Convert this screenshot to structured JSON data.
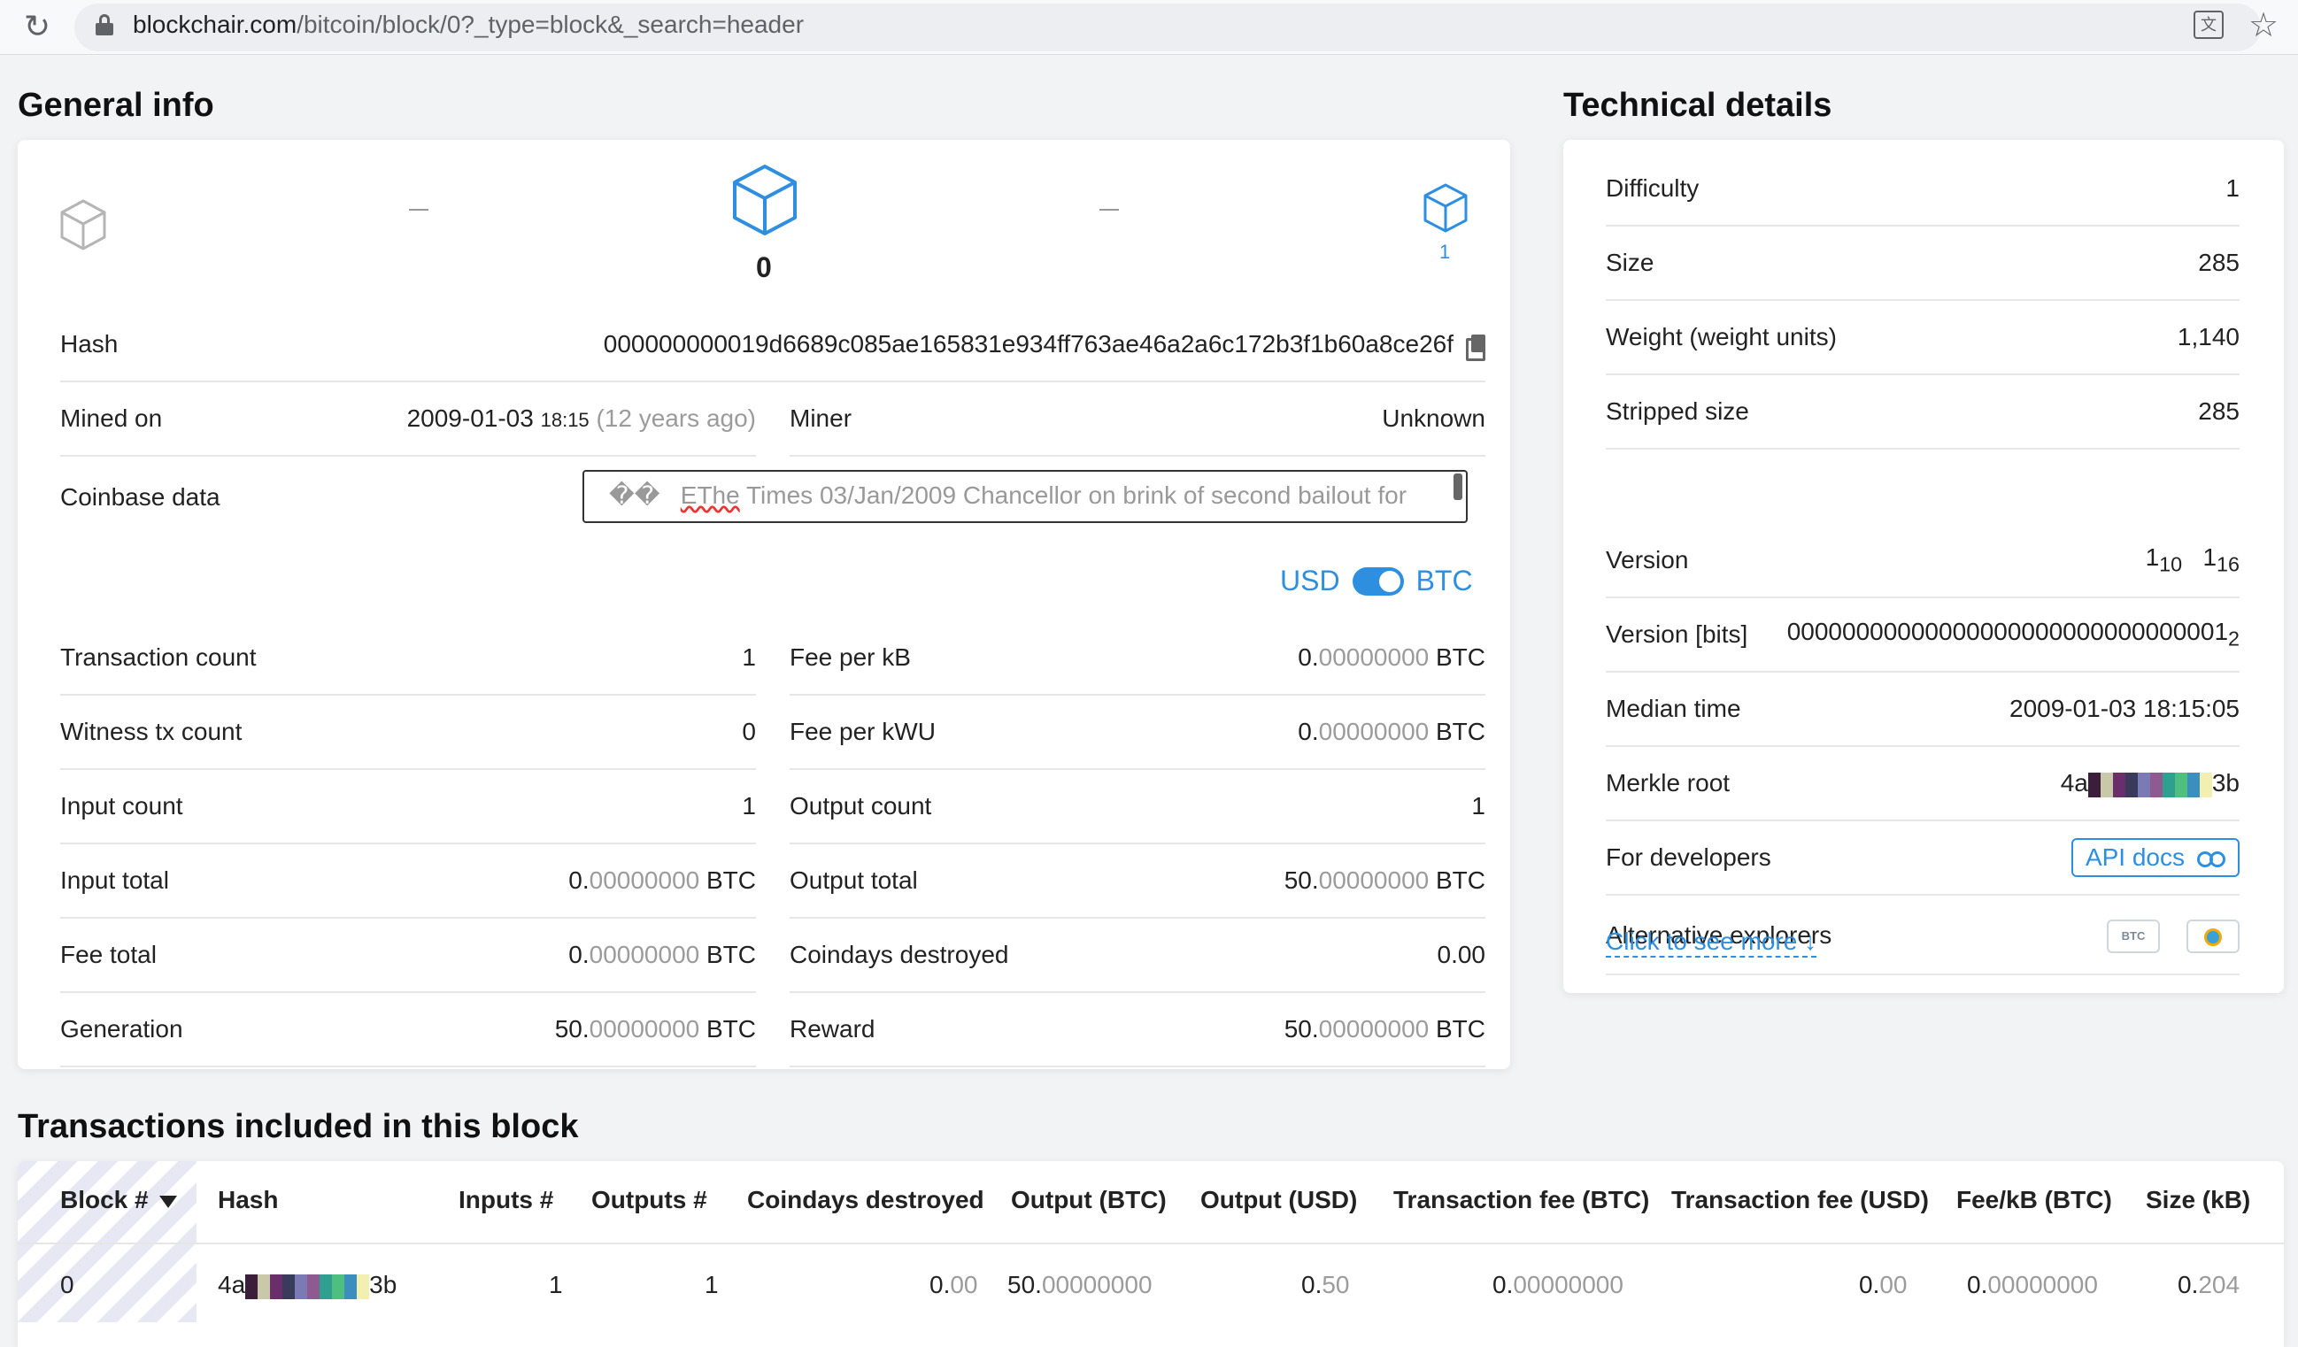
{
  "browser": {
    "url_host": "blockchair.com",
    "url_path": "/bitcoin/block/0?_type=block&_search=header"
  },
  "general": {
    "title": "General info",
    "current_block": "0",
    "next_block": "1",
    "prev_dash": "–",
    "next_dash": "–",
    "hash_label": "Hash",
    "hash_value": "000000000019d6689c085ae165831e934ff763ae46a2a6c172b3f1b60a8ce26f",
    "mined_label": "Mined on",
    "mined_date": "2009-01-03",
    "mined_time": "18:15",
    "mined_ago": "(12 years ago)",
    "miner_label": "Miner",
    "miner_value": "Unknown",
    "coinbase_label": "Coinbase data",
    "coinbase_prefix": "��",
    "coinbase_marked": "EThe",
    "coinbase_rest": " Times 03/Jan/2009 Chancellor on brink of second bailout for",
    "toggle_left": "USD",
    "toggle_right": "BTC",
    "left_rows": [
      {
        "label": "Transaction count",
        "int": "1",
        "dec": "",
        "unit": "",
        "blue": true
      },
      {
        "label": "Witness tx count",
        "int": "0",
        "dec": "",
        "unit": "",
        "blue": true
      },
      {
        "label": "Input count",
        "int": "1",
        "dec": "",
        "unit": "",
        "blue": true
      },
      {
        "label": "Input total",
        "int": "0.",
        "dec": "00000000",
        "unit": " BTC",
        "blue": false
      },
      {
        "label": "Fee total",
        "int": "0.",
        "dec": "00000000",
        "unit": " BTC",
        "blue": false
      },
      {
        "label": "Generation",
        "int": "50.",
        "dec": "00000000",
        "unit": " BTC",
        "blue": false
      }
    ],
    "right_rows": [
      {
        "label": "Fee per kB",
        "int": "0.",
        "dec": "00000000",
        "unit": " BTC",
        "blue": false
      },
      {
        "label": "Fee per kWU",
        "int": "0.",
        "dec": "00000000",
        "unit": " BTC",
        "blue": false
      },
      {
        "label": "Output count",
        "int": "1",
        "dec": "",
        "unit": "",
        "blue": true
      },
      {
        "label": "Output total",
        "int": "50.",
        "dec": "00000000",
        "unit": " BTC",
        "blue": false
      },
      {
        "label": "Coindays destroyed",
        "int": "0.00",
        "dec": "",
        "unit": "",
        "blue": false
      },
      {
        "label": "Reward",
        "int": "50.",
        "dec": "00000000",
        "unit": " BTC",
        "blue": false
      }
    ]
  },
  "technical": {
    "title": "Technical details",
    "rows": [
      {
        "label": "Difficulty",
        "value": "1"
      },
      {
        "label": "Size",
        "value": "285"
      },
      {
        "label": "Weight (weight units)",
        "value": "1,140"
      },
      {
        "label": "Stripped size",
        "value": "285"
      }
    ],
    "version_label": "Version",
    "version_a": "1",
    "version_a_sub": "10",
    "version_b": "1",
    "version_b_sub": "16",
    "bits_label": "Version [bits]",
    "bits_value": "00000000000000000000000000000001",
    "bits_sub": "2",
    "median_label": "Median time",
    "median_value": "2009-01-03 18:15:05",
    "merkle_label": "Merkle root",
    "merkle_start": "4a",
    "merkle_end": "3b",
    "dev_label": "For developers",
    "api_label": "API docs",
    "alt_label": "Alternative explorers",
    "alt_btc": "BTC",
    "see_more": "Click to see more"
  },
  "transactions": {
    "title": "Transactions included in this block",
    "headers": [
      "Block #",
      "Hash",
      "Inputs #",
      "Outputs #",
      "Coindays destroyed",
      "Output (BTC)",
      "Output (USD)",
      "Transaction fee (BTC)",
      "Transaction fee (USD)",
      "Fee/kB (BTC)",
      "Size (kB)"
    ],
    "row": {
      "block": "0",
      "hash_start": "4a",
      "hash_end": "3b",
      "inputs": "1",
      "outputs": "1",
      "cdd_int": "0.",
      "cdd_dec": "00",
      "out_btc_int": "50.",
      "out_btc_dec": "00000000",
      "out_usd_int": "0.",
      "out_usd_dec": "50",
      "fee_btc_int": "0.",
      "fee_btc_dec": "00000000",
      "fee_usd_int": "0.",
      "fee_usd_dec": "00",
      "feekb_int": "0.",
      "feekb_dec": "00000000",
      "size_int": "0.",
      "size_dec": "204"
    }
  },
  "colors": {
    "accent": "#2e8fe0",
    "hash_swatches": [
      "#3b1f3a",
      "#c9c9a9",
      "#6a2f6b",
      "#3a3a5a",
      "#7a7ab5",
      "#8f5a8f",
      "#2f9f8f",
      "#4fbf7f",
      "#3a8fbf",
      "#f2efb0"
    ]
  }
}
